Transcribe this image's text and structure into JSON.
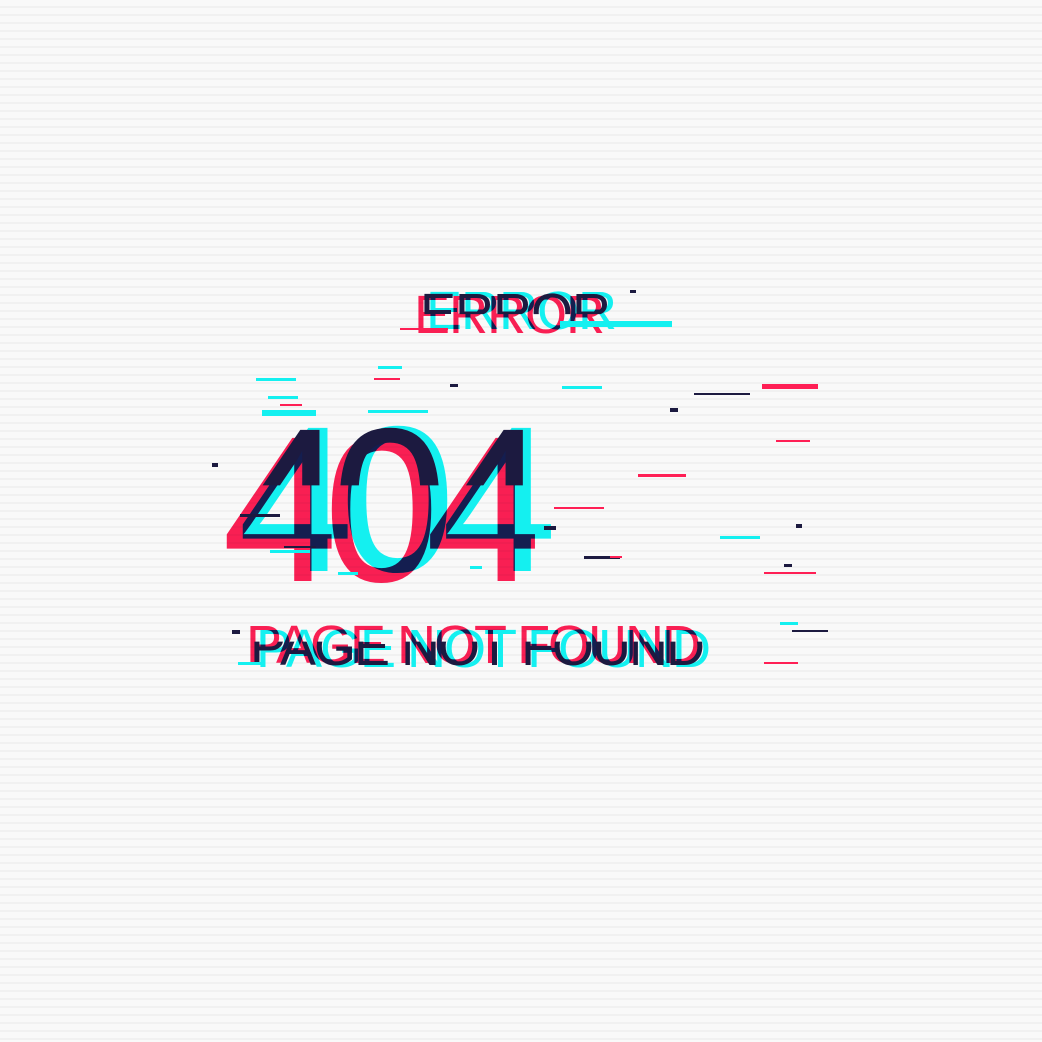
{
  "error_label": "ERROR",
  "error_code": "404",
  "message": "PAGE NOT FOUND",
  "colors": {
    "background": "#f7f7f7",
    "cyan": "#14f0f0",
    "red": "#ff1f55",
    "dark": "#1c1a40"
  }
}
